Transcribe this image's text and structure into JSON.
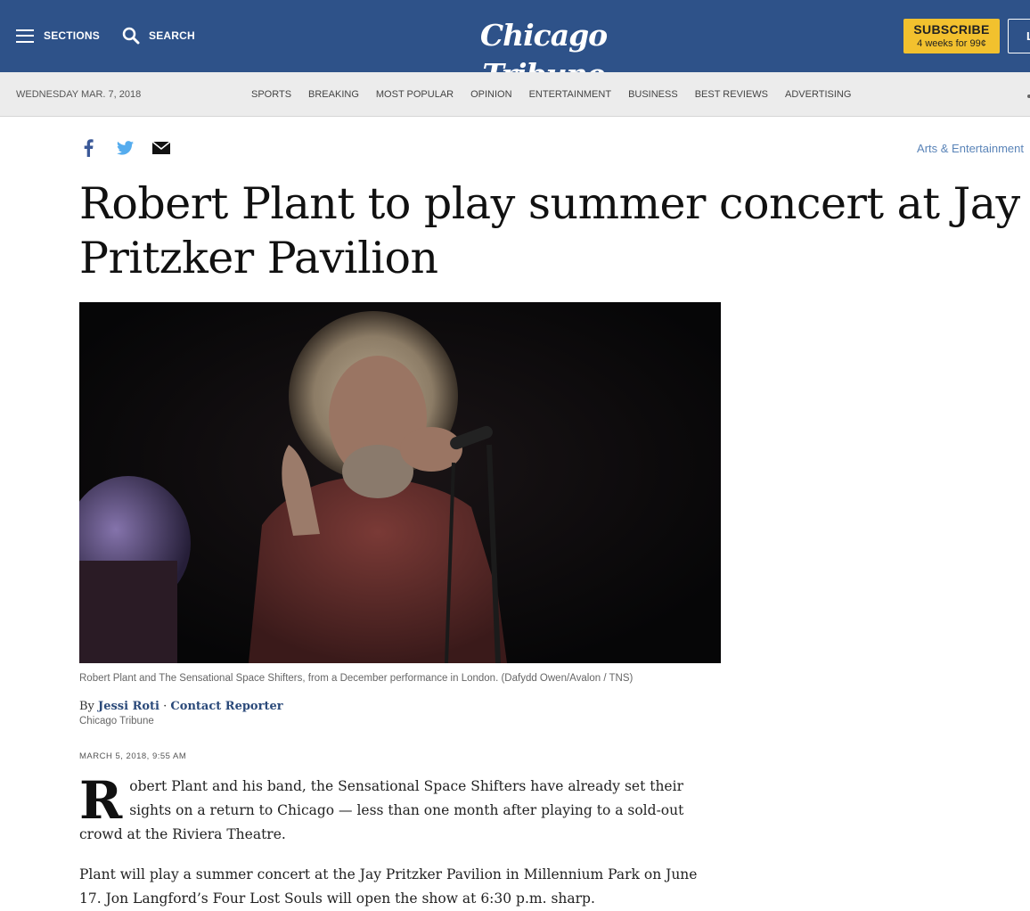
{
  "header": {
    "sections_label": "SECTIONS",
    "search_label": "SEARCH",
    "logo_text": "Chicago Tribune",
    "subscribe_label": "SUBSCRIBE",
    "subscribe_offer": "4 weeks for 99¢",
    "login_label": "L"
  },
  "subnav": {
    "date": "WEDNESDAY MAR. 7, 2018",
    "links": [
      "SPORTS",
      "BREAKING",
      "MOST POPULAR",
      "OPINION",
      "ENTERTAINMENT",
      "BUSINESS",
      "BEST REVIEWS",
      "ADVERTISING"
    ]
  },
  "share": {
    "icons": [
      "facebook-icon",
      "twitter-icon",
      "email-icon"
    ]
  },
  "article": {
    "section": "Arts & Entertainment",
    "headline": "Robert Plant to play summer concert at Jay Pritzker Pavilion",
    "caption": "Robert Plant and The Sensational Space Shifters, from a December performance in London. (Dafydd Owen/Avalon / TNS)",
    "byline_prefix": "By",
    "author": "Jessi Roti",
    "separator": "·",
    "contact_label": "Contact Reporter",
    "organization": "Chicago Tribune",
    "timestamp": "MARCH 5, 2018, 9:55 AM",
    "dropcap": "R",
    "paragraph1": "obert Plant and his band, the Sensational Space Shifters have already set their sights on a return to Chicago — less than one month after playing to a sold-out crowd at the Riviera Theatre.",
    "paragraph2": "Plant will play a summer concert at the Jay Pritzker Pavilion in Millennium Park on June 17. Jon Langford’s Four Lost Souls will open the show at 6:30 p.m. sharp."
  },
  "colors": {
    "header_bg": "#2e5289",
    "subscribe_bg": "#f2c12e",
    "subnav_bg": "#ececec",
    "link_blue": "#2b4a7a"
  }
}
